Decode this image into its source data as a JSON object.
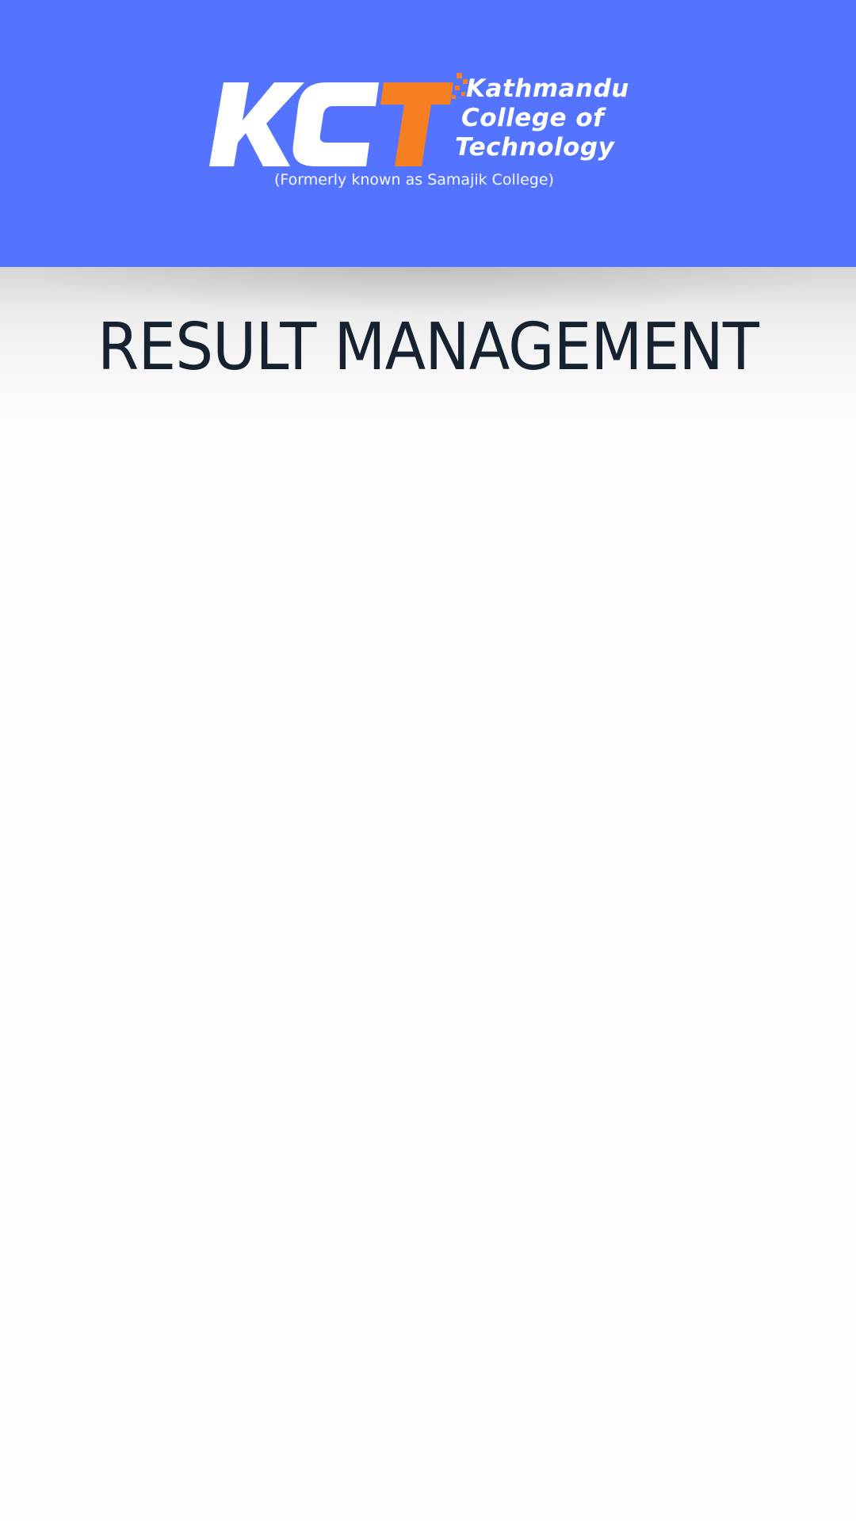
{
  "header": {
    "logo": {
      "mark": "KCT",
      "name_lines": [
        "Kathmandu",
        "College of",
        "Technology"
      ],
      "tagline": "(Formerly known as Samajik College)"
    }
  },
  "main": {
    "title": "RESULT MANAGEMENT"
  },
  "colors": {
    "header_bg": "#5474ff",
    "logo_accent": "#f57f21",
    "title_text": "#16222f",
    "page_bg": "#fdfdfd"
  }
}
